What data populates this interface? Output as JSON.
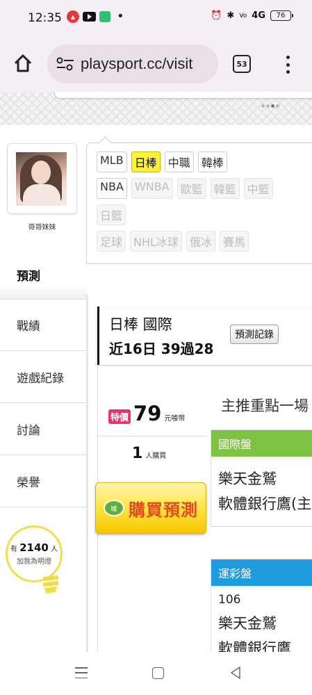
{
  "status_bar": {
    "time": "12:35",
    "battery": "76",
    "signal_label": "4G"
  },
  "browser": {
    "url": "playsport.cc/visit",
    "tab_count": "53"
  },
  "profile": {
    "username": "哥哥妹妹"
  },
  "sidebar": {
    "active": "預測",
    "items": [
      {
        "label": "戰績"
      },
      {
        "label": "遊戲紀錄"
      },
      {
        "label": "討論"
      },
      {
        "label": "榮譽"
      }
    ],
    "bulb": {
      "prefix": "有",
      "count": "2140",
      "suffix": "人",
      "caption": "加我為明燈"
    }
  },
  "sports": {
    "row1": [
      "MLB",
      "日棒",
      "中職",
      "韓棒"
    ],
    "row2": [
      "NBA",
      "WNBA",
      "歐籃",
      "韓籃",
      "中籃"
    ],
    "row3": [
      "日籃"
    ],
    "row4": [
      "足球",
      "NHL冰球",
      "俄冰",
      "賽馬"
    ],
    "active": "日棒"
  },
  "record": {
    "league": "日棒 國際",
    "stat": "近16日 39過28",
    "button": "預測記錄"
  },
  "offer": {
    "badge": "特價",
    "price": "79",
    "unit": "元噱幣",
    "buyers": "1",
    "buyers_unit": "人購買",
    "buy_icon": "噱",
    "buy_label": "購買預測"
  },
  "main": {
    "headline": "主推重點一場",
    "intl_panel": {
      "title": "國際盤",
      "teams": [
        "樂天金鷲",
        "軟體銀行鷹(主)"
      ]
    },
    "lottery_panel": {
      "title": "運彩盤",
      "number": "106",
      "teams": [
        "樂天金鷲",
        "軟體銀行鷹"
      ]
    }
  },
  "colors": {
    "accent_yellow": "#fff23a",
    "intl_green": "#7dc242",
    "lottery_blue": "#1f9ce0",
    "price_pink": "#e8336b",
    "buy_text": "#e14a1f"
  }
}
